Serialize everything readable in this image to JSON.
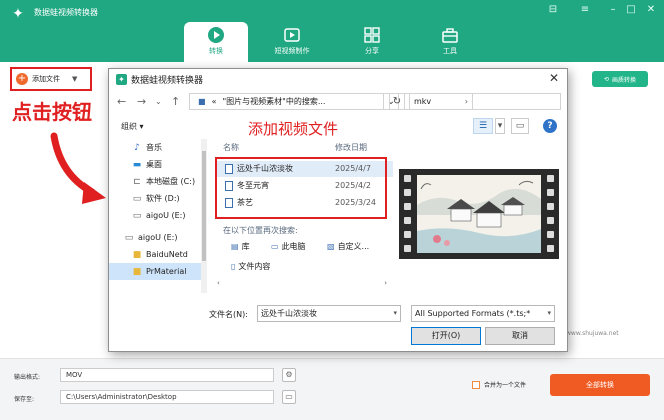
{
  "app": {
    "title": "数据蛙视频转换器",
    "window_controls": [
      "minimize-icon",
      "menu-icon",
      "restore-icon",
      "close-icon"
    ]
  },
  "nav": {
    "tabs": [
      {
        "label": "转换",
        "icon": "convert-icon",
        "active": true
      },
      {
        "label": "短视频制作",
        "icon": "short-video-icon",
        "active": false
      },
      {
        "label": "分享",
        "icon": "share-icon",
        "active": false
      },
      {
        "label": "工具",
        "icon": "toolbox-icon",
        "active": false
      }
    ]
  },
  "toolbar": {
    "add_file": "添加文件",
    "convert_btn": "画质转换"
  },
  "annotations": {
    "click_button": "点击按钮",
    "add_video": "添加视频文件"
  },
  "footer": {
    "output_format_label": "输出格式:",
    "output_format_value": "MOV",
    "save_to_label": "保存至:",
    "save_to_value": "C:\\Users\\Administrator\\Desktop",
    "merge_label": "合并为一个文件",
    "convert_all": "全部转换"
  },
  "watermark": "www.shujuwa.net",
  "dialog": {
    "title": "数据蛙视频转换器",
    "address": {
      "icon_seg": "«",
      "path": "\"图片与视频素材\"中的搜索..."
    },
    "search_value": "mkv",
    "organize": "组织 ▾",
    "nav_items": [
      {
        "label": "音乐",
        "icon": "music-icon",
        "selected": false
      },
      {
        "label": "桌面",
        "icon": "desktop-icon",
        "selected": false
      },
      {
        "label": "本地磁盘 (C:)",
        "icon": "drive-icon",
        "selected": false
      },
      {
        "label": "软件 (D:)",
        "icon": "drive-icon",
        "selected": false
      },
      {
        "label": "aigoU (E:)",
        "icon": "drive-icon",
        "selected": false
      },
      {
        "label": "aigoU (E:)",
        "icon": "usb-drive-icon",
        "selected": false
      },
      {
        "label": "BaiduNetd",
        "icon": "folder-icon",
        "selected": false
      },
      {
        "label": "PrMaterial",
        "icon": "folder-icon",
        "selected": true
      }
    ],
    "columns": {
      "name": "名称",
      "date": "修改日期"
    },
    "files": [
      {
        "name": "远处千山浓淡妆",
        "date": "2025/4/7",
        "selected": true
      },
      {
        "name": "冬至元宵",
        "date": "2025/4/2",
        "selected": false
      },
      {
        "name": "茶艺",
        "date": "2025/3/24",
        "selected": false
      }
    ],
    "search_again_label": "在以下位置再次搜索:",
    "search_locations": [
      {
        "label": "库",
        "icon": "library-icon"
      },
      {
        "label": "此电脑",
        "icon": "computer-icon"
      },
      {
        "label": "自定义...",
        "icon": "custom-folder-icon"
      },
      {
        "label": "文件内容",
        "icon": "file-content-icon"
      }
    ],
    "filename_label": "文件名(N):",
    "filename_value": "远处千山浓淡妆",
    "filetype_value": "All Supported Formats (*.ts;*",
    "open_btn": "打开(O)",
    "cancel_btn": "取消"
  },
  "colors": {
    "brand": "#1fa882",
    "accent_orange": "#f05b24",
    "annotation_red": "#e02020"
  }
}
